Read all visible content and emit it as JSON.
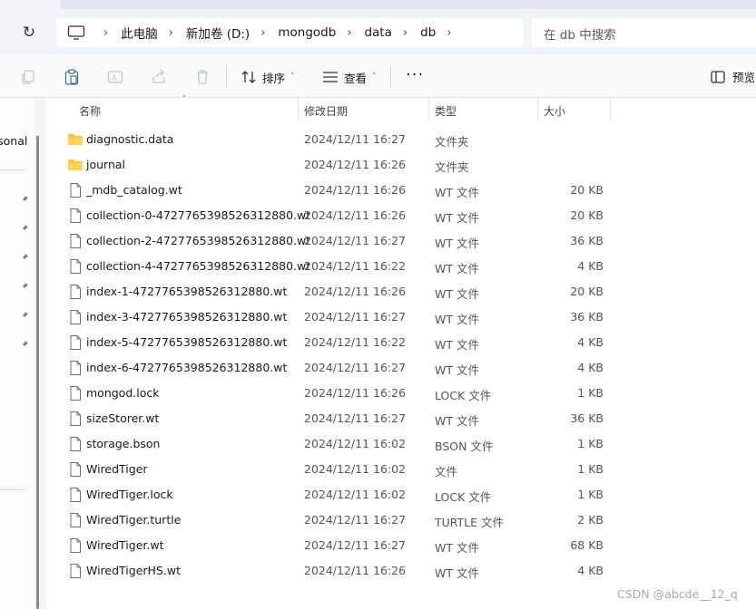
{
  "address_bar": {
    "crumbs": [
      "此电脑",
      "新加卷 (D:)",
      "mongodb",
      "data",
      "db"
    ],
    "search_placeholder": "在 db 中搜索"
  },
  "toolbar": {
    "sort_label": "排序",
    "view_label": "查看",
    "more_label": "···",
    "preview_label": "预览"
  },
  "nav": {
    "personal_label": "rsonal"
  },
  "columns": {
    "name": "名称",
    "date": "修改日期",
    "type": "类型",
    "size": "大小"
  },
  "files": [
    {
      "name": "diagnostic.data",
      "date": "2024/12/11 16:27",
      "type": "文件夹",
      "size": "",
      "icon": "folder-icon"
    },
    {
      "name": "journal",
      "date": "2024/12/11 16:26",
      "type": "文件夹",
      "size": "",
      "icon": "folder-icon"
    },
    {
      "name": "_mdb_catalog.wt",
      "date": "2024/12/11 16:26",
      "type": "WT 文件",
      "size": "20 KB",
      "icon": "file-icon"
    },
    {
      "name": "collection-0-4727765398526312880.wt",
      "date": "2024/12/11 16:26",
      "type": "WT 文件",
      "size": "20 KB",
      "icon": "file-icon"
    },
    {
      "name": "collection-2-4727765398526312880.wt",
      "date": "2024/12/11 16:27",
      "type": "WT 文件",
      "size": "36 KB",
      "icon": "file-icon"
    },
    {
      "name": "collection-4-4727765398526312880.wt",
      "date": "2024/12/11 16:22",
      "type": "WT 文件",
      "size": "4 KB",
      "icon": "file-icon"
    },
    {
      "name": "index-1-4727765398526312880.wt",
      "date": "2024/12/11 16:26",
      "type": "WT 文件",
      "size": "20 KB",
      "icon": "file-icon"
    },
    {
      "name": "index-3-4727765398526312880.wt",
      "date": "2024/12/11 16:27",
      "type": "WT 文件",
      "size": "36 KB",
      "icon": "file-icon"
    },
    {
      "name": "index-5-4727765398526312880.wt",
      "date": "2024/12/11 16:22",
      "type": "WT 文件",
      "size": "4 KB",
      "icon": "file-icon"
    },
    {
      "name": "index-6-4727765398526312880.wt",
      "date": "2024/12/11 16:27",
      "type": "WT 文件",
      "size": "4 KB",
      "icon": "file-icon"
    },
    {
      "name": "mongod.lock",
      "date": "2024/12/11 16:26",
      "type": "LOCK 文件",
      "size": "1 KB",
      "icon": "file-icon"
    },
    {
      "name": "sizeStorer.wt",
      "date": "2024/12/11 16:27",
      "type": "WT 文件",
      "size": "36 KB",
      "icon": "file-icon"
    },
    {
      "name": "storage.bson",
      "date": "2024/12/11 16:02",
      "type": "BSON 文件",
      "size": "1 KB",
      "icon": "file-icon"
    },
    {
      "name": "WiredTiger",
      "date": "2024/12/11 16:02",
      "type": "文件",
      "size": "1 KB",
      "icon": "file-icon"
    },
    {
      "name": "WiredTiger.lock",
      "date": "2024/12/11 16:02",
      "type": "LOCK 文件",
      "size": "1 KB",
      "icon": "file-icon"
    },
    {
      "name": "WiredTiger.turtle",
      "date": "2024/12/11 16:27",
      "type": "TURTLE 文件",
      "size": "2 KB",
      "icon": "file-icon"
    },
    {
      "name": "WiredTiger.wt",
      "date": "2024/12/11 16:27",
      "type": "WT 文件",
      "size": "68 KB",
      "icon": "file-icon"
    },
    {
      "name": "WiredTigerHS.wt",
      "date": "2024/12/11 16:26",
      "type": "WT 文件",
      "size": "4 KB",
      "icon": "file-icon"
    }
  ],
  "watermark": "CSDN @abcde__12_q"
}
